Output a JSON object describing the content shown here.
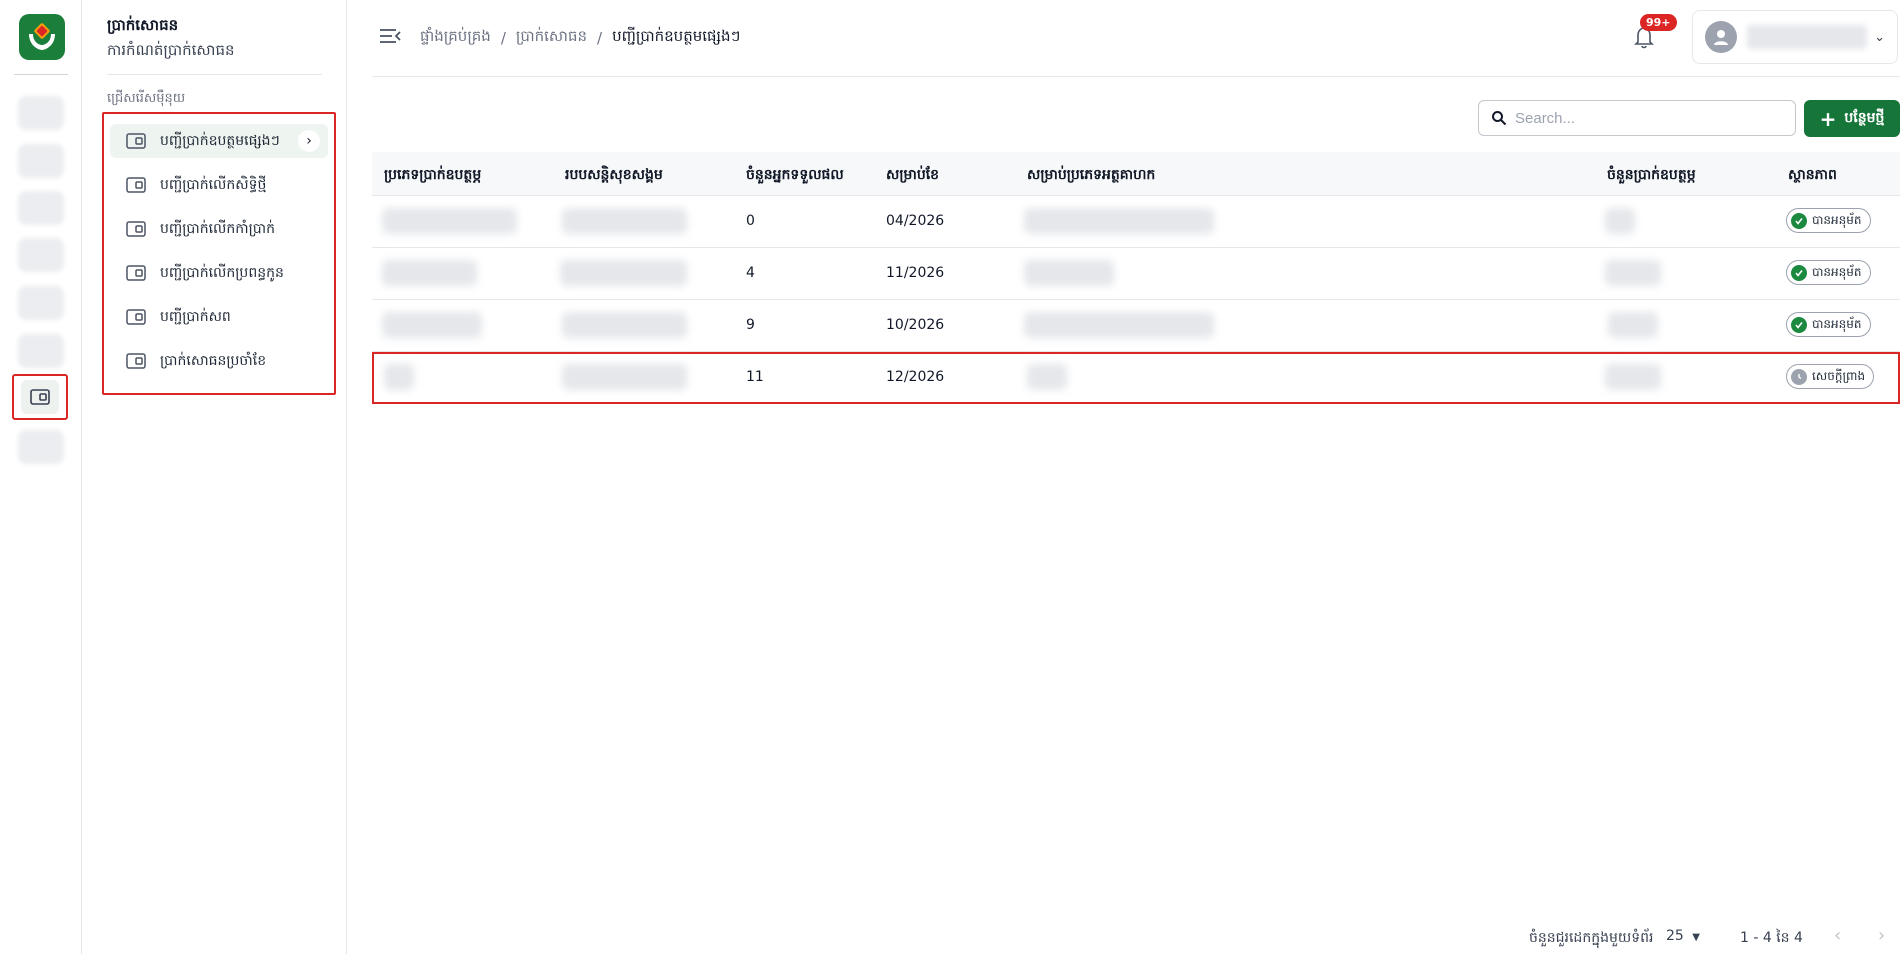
{
  "colors": {
    "brand": "#16763a",
    "highlight": "#dc2626",
    "badge": "#dc2626",
    "approved": "#1b8a3f",
    "draft": "#9ca3af"
  },
  "rail": {
    "logo_icon": "hands-logo-icon",
    "active_icon": "wallet-icon"
  },
  "subnav": {
    "title": "ប្រាក់សោធន",
    "subtitle": "ការកំណត់ប្រាក់សោធន",
    "section_label": "ជ្រើសរើសម៉ឺនុយ",
    "items": [
      {
        "label": "បញ្ជីប្រាក់ឧបត្ថមផ្សេងៗ",
        "icon": "wallet-icon"
      },
      {
        "label": "បញ្ជីប្រាក់លើកសិទ្ធិថ្មី",
        "icon": "wallet-icon"
      },
      {
        "label": "បញ្ជីប្រាក់លើកកាំប្រាក់",
        "icon": "wallet-icon"
      },
      {
        "label": "បញ្ជីប្រាក់លើកប្រពន្ធកូន",
        "icon": "wallet-icon"
      },
      {
        "label": "បញ្ជីប្រាក់សព",
        "icon": "wallet-icon"
      },
      {
        "label": "ប្រាក់សោធនប្រចាំខែ",
        "icon": "wallet-icon"
      }
    ]
  },
  "header": {
    "breadcrumb": [
      "ផ្ទាំងគ្រប់គ្រង",
      "ប្រាក់សោធន",
      "បញ្ជីប្រាក់ឧបត្ថមផ្សេងៗ"
    ],
    "separator": "/",
    "notification_badge": "99+",
    "user_chevron": "⌄"
  },
  "toolbar": {
    "search_placeholder": "Search...",
    "add_label": "បន្ថែមថ្មី"
  },
  "table": {
    "headers": [
      "ប្រភេទប្រាក់ឧបត្ថម្ភ",
      "របបសន្តិសុខសង្គម",
      "ចំនួនអ្នកទទួលផល",
      "សម្រាប់ខែ",
      "សម្រាប់ប្រភេទអត្ថគាហក",
      "ចំនួនប្រាក់ឧបត្ថម្ភ",
      "ស្ថានភាព"
    ],
    "rows": [
      {
        "beneficiaries": "0",
        "month": "04/2026",
        "status": "បានអនុម័ត",
        "status_type": "approved"
      },
      {
        "beneficiaries": "4",
        "month": "11/2026",
        "status": "បានអនុម័ត",
        "status_type": "approved"
      },
      {
        "beneficiaries": "9",
        "month": "10/2026",
        "status": "បានអនុម័ត",
        "status_type": "approved"
      },
      {
        "beneficiaries": "11",
        "month": "12/2026",
        "status": "សេចក្តីព្រាង",
        "status_type": "draft"
      }
    ]
  },
  "pagination": {
    "rows_per_page_label": "ចំនួនជួរដេកក្នុងមួយទំព័រ",
    "rows_per_page_value": "25",
    "range_label": "1 - 4 នៃ 4",
    "prev": "‹",
    "next": "›"
  }
}
